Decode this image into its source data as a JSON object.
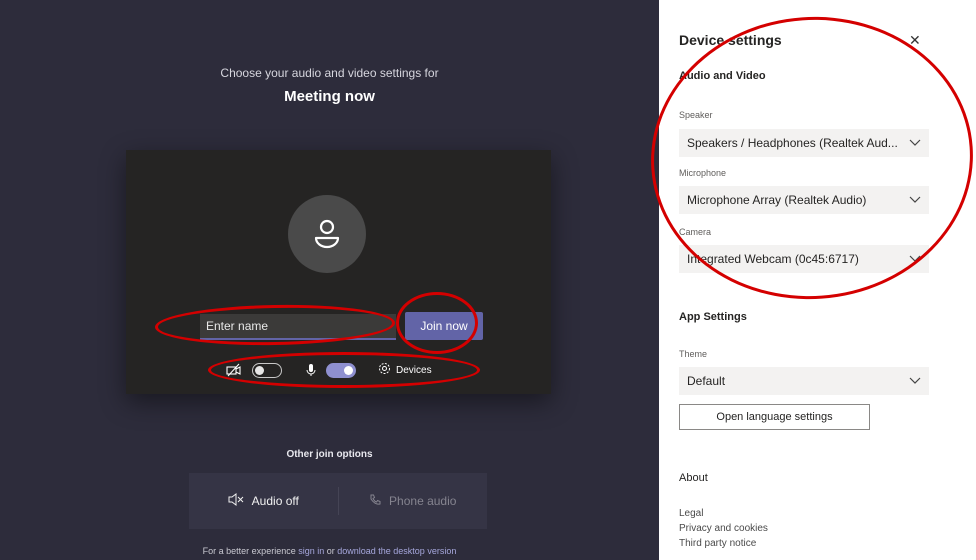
{
  "prejoin": {
    "choose_text": "Choose your audio and video settings for",
    "meeting_title": "Meeting now",
    "name_placeholder": "Enter name",
    "join_label": "Join now",
    "camera_state": "off",
    "mic_state": "on",
    "devices_label": "Devices"
  },
  "other_options": {
    "title": "Other join options",
    "audio_off_label": "Audio off",
    "phone_audio_label": "Phone audio"
  },
  "footer": {
    "prefix": "For a better experience ",
    "sign_in": "sign in",
    "middle": " or ",
    "download": "download the desktop version"
  },
  "device_settings": {
    "title": "Device settings",
    "audio_video_heading": "Audio and Video",
    "speaker_label": "Speaker",
    "speaker_value": "Speakers / Headphones (Realtek Aud...",
    "microphone_label": "Microphone",
    "microphone_value": "Microphone Array (Realtek Audio)",
    "camera_label": "Camera",
    "camera_value": "Integrated Webcam (0c45:6717)",
    "app_settings_heading": "App Settings",
    "theme_label": "Theme",
    "theme_value": "Default",
    "language_button": "Open language settings",
    "about_heading": "About",
    "about_links": [
      "Legal",
      "Privacy and cookies",
      "Third party notice"
    ]
  },
  "colors": {
    "accent": "#6264a7",
    "annotation": "#d40000",
    "background": "#2d2c3b"
  }
}
